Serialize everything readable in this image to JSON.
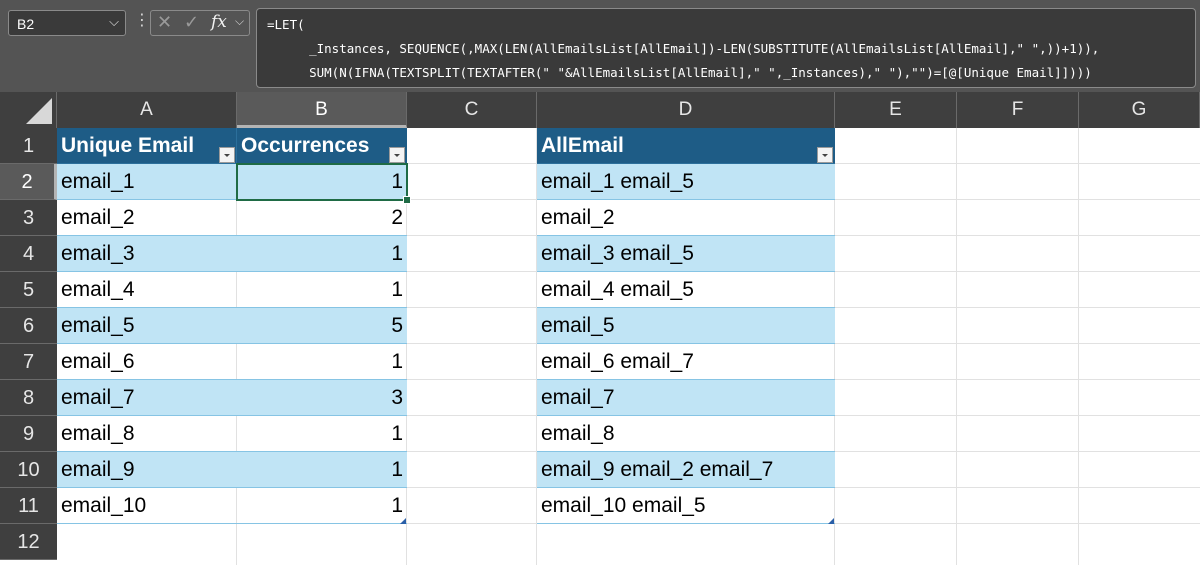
{
  "name_box": {
    "ref": "B2"
  },
  "formula_bar": {
    "lines": [
      "=LET(",
      "    _Instances, SEQUENCE(,MAX(LEN(AllEmailsList[AllEmail])-LEN(SUBSTITUTE(AllEmailsList[AllEmail],\" \",))+1)),",
      "    SUM(N(IFNA(TEXTSPLIT(TEXTAFTER(\" \"&AllEmailsList[AllEmail],\" \",_Instances),\" \"),\"\")=[@[Unique Email]])))"
    ]
  },
  "icons": {
    "fx": "fx",
    "cancel": "✕",
    "enter": "✓",
    "chevron": "⌵",
    "more": "⋮"
  },
  "columns": [
    "A",
    "B",
    "C",
    "D",
    "E",
    "F",
    "G"
  ],
  "rows": [
    "1",
    "2",
    "3",
    "4",
    "5",
    "6",
    "7",
    "8",
    "9",
    "10",
    "11",
    "12"
  ],
  "table1": {
    "headers": [
      "Unique Email",
      "Occurrences"
    ],
    "rows": [
      [
        "email_1",
        "1"
      ],
      [
        "email_2",
        "2"
      ],
      [
        "email_3",
        "1"
      ],
      [
        "email_4",
        "1"
      ],
      [
        "email_5",
        "5"
      ],
      [
        "email_6",
        "1"
      ],
      [
        "email_7",
        "3"
      ],
      [
        "email_8",
        "1"
      ],
      [
        "email_9",
        "1"
      ],
      [
        "email_10",
        "1"
      ]
    ]
  },
  "table2": {
    "header": "AllEmail",
    "rows": [
      "email_1 email_5",
      "email_2",
      "email_3 email_5",
      "email_4 email_5",
      "email_5",
      "email_6 email_7",
      "email_7",
      "email_8",
      "email_9 email_2 email_7",
      "email_10 email_5"
    ]
  },
  "colors": {
    "header_fill": "#1e5c86",
    "band_fill": "#c0e4f5",
    "selection": "#1f6b45"
  }
}
